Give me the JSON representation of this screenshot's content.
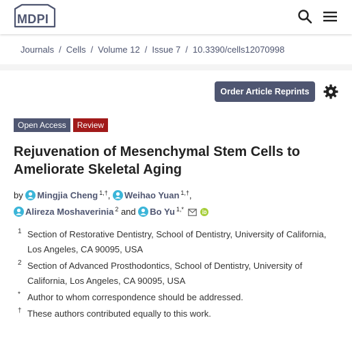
{
  "header": {
    "logo_text": "MDPI",
    "icons": [
      "search-icon",
      "menu-icon"
    ]
  },
  "breadcrumb": [
    "Journals",
    "Cells",
    "Volume 12",
    "Issue 7",
    "10.3390/cells12070998"
  ],
  "toolbar": {
    "order_label": "Order Article Reprints",
    "settings_icon": "gear-icon"
  },
  "badges": {
    "open_access": "Open Access",
    "type": "Review"
  },
  "colors": {
    "brand": "#4f5671",
    "review_badge": "#a11a1a",
    "avatar": "#3bb5d8",
    "orcid": "#a6ce39"
  },
  "article": {
    "title": "Rejuvenation of Mesenchymal Stem Cells to Ameliorate Skeletal Aging",
    "by": "by",
    "authors": [
      {
        "name": "Mingjia Cheng",
        "sup": "1,†",
        "after": ","
      },
      {
        "name": "Weihao Yuan",
        "sup": "1,†",
        "after": ","
      },
      {
        "name": "Alireza Moshaverinia",
        "sup": "2",
        "after": " and"
      },
      {
        "name": "Bo Yu",
        "sup": "1,*",
        "after": ""
      }
    ],
    "affiliations": [
      {
        "mark": "1",
        "text": "Section of Restorative Dentistry, School of Dentistry, University of California, Los Angeles, CA 90095, USA"
      },
      {
        "mark": "2",
        "text": "Section of Advanced Prosthodontics, School of Dentistry, University of California, Los Angeles, CA 90095, USA"
      },
      {
        "mark": "*",
        "text": "Author to whom correspondence should be addressed."
      },
      {
        "mark": "†",
        "text": "These authors contributed equally to this work."
      }
    ]
  }
}
